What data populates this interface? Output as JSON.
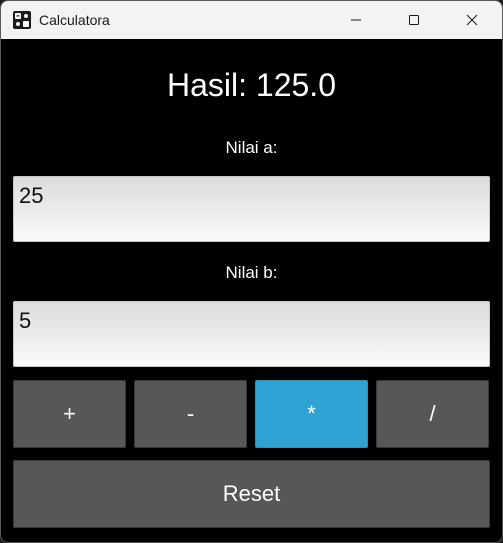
{
  "window": {
    "title": "Calculatora",
    "app_icon": "calculator-app-icon",
    "controls": [
      "minimize-icon",
      "maximize-icon",
      "close-icon"
    ]
  },
  "result": {
    "text": "Hasil: 125.0"
  },
  "input_a": {
    "label": "Nilai a:",
    "value": "25"
  },
  "input_b": {
    "label": "Nilai b:",
    "value": "5"
  },
  "operations": {
    "plus": "+",
    "minus": "-",
    "multiply": "*",
    "divide": "/",
    "selected": "*"
  },
  "reset": {
    "label": "Reset"
  },
  "colors": {
    "background": "#000000",
    "button": "#575757",
    "accent": "#2ea2d2",
    "titlebar": "#f3f3f3"
  }
}
